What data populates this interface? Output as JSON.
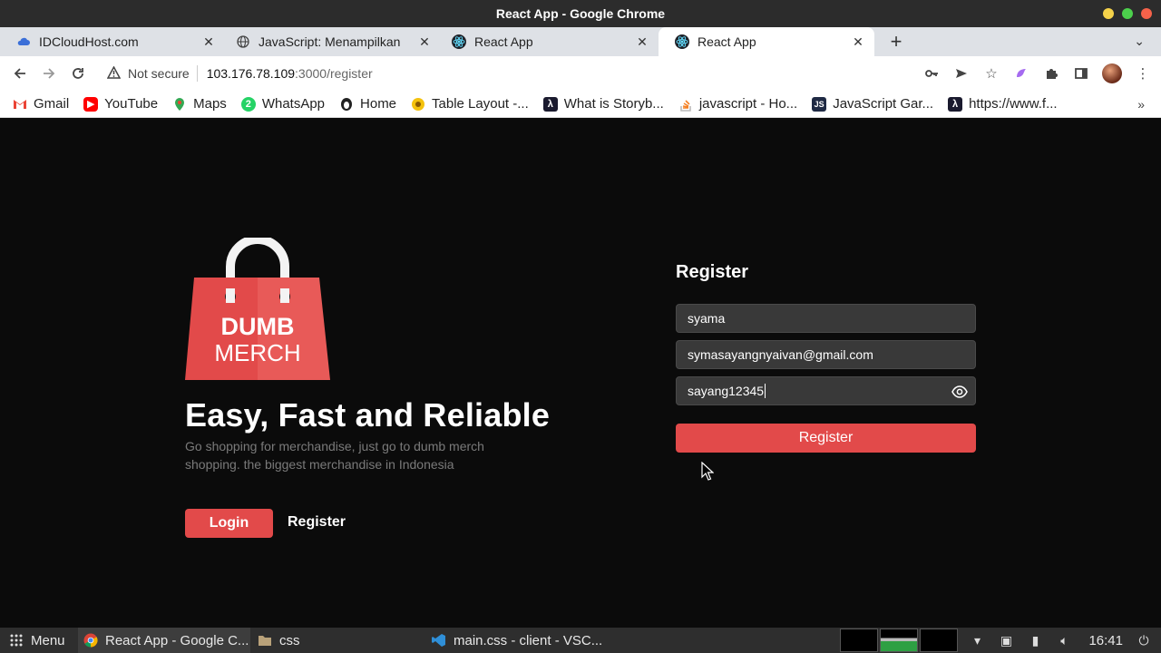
{
  "window": {
    "title": "React App - Google Chrome"
  },
  "tabs": [
    {
      "title": "IDCloudHost.com",
      "icon": "cloud-icon"
    },
    {
      "title": "JavaScript: Menampilkan",
      "icon": "globe-icon"
    },
    {
      "title": "React App",
      "icon": "react-icon"
    },
    {
      "title": "React App",
      "icon": "react-icon",
      "active": true
    }
  ],
  "toolbar": {
    "security_label": "Not secure",
    "url_host": "103.176.78.109",
    "url_path": ":3000/register"
  },
  "bookmarks": [
    {
      "label": "Gmail",
      "icon": "gmail-icon"
    },
    {
      "label": "YouTube",
      "icon": "youtube-icon"
    },
    {
      "label": "Maps",
      "icon": "maps-icon"
    },
    {
      "label": "WhatsApp",
      "icon": "whatsapp-icon"
    },
    {
      "label": "Home",
      "icon": "home-icon"
    },
    {
      "label": "Table Layout -...",
      "icon": "sunflower-icon"
    },
    {
      "label": "What is Storyb...",
      "icon": "storybook-icon"
    },
    {
      "label": "javascript - Ho...",
      "icon": "stackoverflow-icon"
    },
    {
      "label": "JavaScript Gar...",
      "icon": "js-icon"
    },
    {
      "label": "https://www.f...",
      "icon": "storybook-icon"
    }
  ],
  "page": {
    "logo_line1": "DUMB",
    "logo_line2": "MERCH",
    "headline": "Easy, Fast and Reliable",
    "subtext": "Go shopping for merchandise, just go to dumb merch shopping. the biggest merchandise in Indonesia",
    "login_label": "Login",
    "register_link_label": "Register"
  },
  "form": {
    "title": "Register",
    "name_value": "syama",
    "email_value": "symasayangnyaivan@gmail.com",
    "password_value": "sayang12345",
    "submit_label": "Register"
  },
  "taskbar": {
    "menu_label": "Menu",
    "items": [
      {
        "label": "React App - Google C...",
        "icon": "chrome-icon"
      },
      {
        "label": "css",
        "icon": "folder-icon"
      },
      {
        "label": "main.css - client - VSC...",
        "icon": "vscode-icon"
      }
    ],
    "clock": "16:41"
  },
  "colors": {
    "accent": "#e24a4a",
    "page_bg": "#0b0b0b",
    "field_bg": "#393939"
  }
}
